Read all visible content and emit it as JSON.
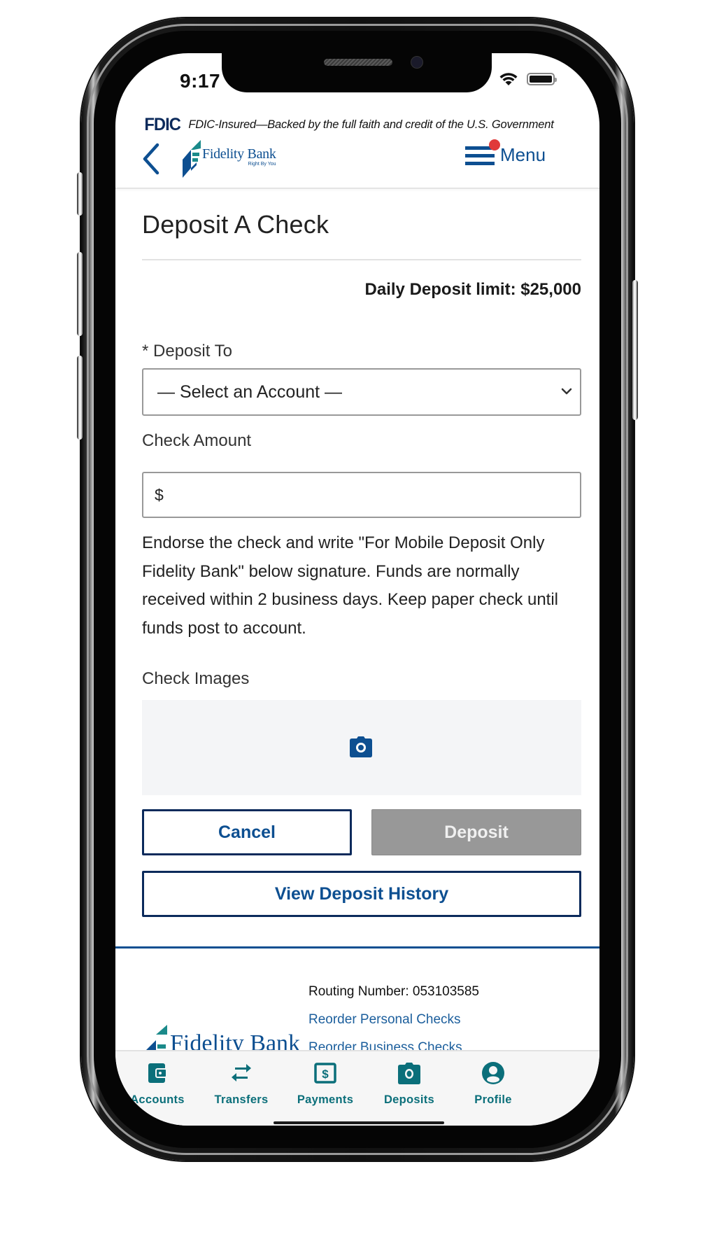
{
  "status_bar": {
    "time": "9:17"
  },
  "fdic_banner": {
    "logo": "FDIC",
    "text": "FDIC-Insured—Backed by the full faith and credit of the U.S. Government"
  },
  "header": {
    "brand_name": "Fidelity Bank",
    "brand_tagline": "Right By You",
    "menu_label": "Menu",
    "menu_has_notification": true
  },
  "page": {
    "title": "Deposit A Check",
    "daily_limit": "Daily Deposit limit: $25,000",
    "deposit_to_label": "* Deposit To",
    "deposit_to_selected": "— Select an Account —",
    "amount_label": "Check Amount",
    "amount_prefix": "$",
    "amount_value": "",
    "instructions": "Endorse the check and write \"For Mobile Deposit Only Fidelity Bank\" below signature. Funds are normally received within 2 business days. Keep paper check until funds post to account.",
    "check_images_label": "Check Images",
    "cancel_label": "Cancel",
    "deposit_label": "Deposit",
    "history_label": "View Deposit History"
  },
  "footer": {
    "routing": "Routing Number: 053103585",
    "links": [
      "Reorder Personal Checks",
      "Reorder Business Checks"
    ],
    "logo_text": "Fidelity Bank"
  },
  "tabbar": {
    "items": [
      {
        "label": "Accounts",
        "icon": "wallet-icon"
      },
      {
        "label": "Transfers",
        "icon": "transfer-arrows-icon"
      },
      {
        "label": "Payments",
        "icon": "dollar-bill-icon"
      },
      {
        "label": "Deposits",
        "icon": "camera-icon"
      },
      {
        "label": "Profile",
        "icon": "user-circle-icon"
      }
    ]
  },
  "colors": {
    "brand_blue": "#0d4f91",
    "navy": "#0b2a5b",
    "teal": "#0b6f7a",
    "notification_red": "#e03a3a",
    "disabled_gray": "#989898"
  }
}
